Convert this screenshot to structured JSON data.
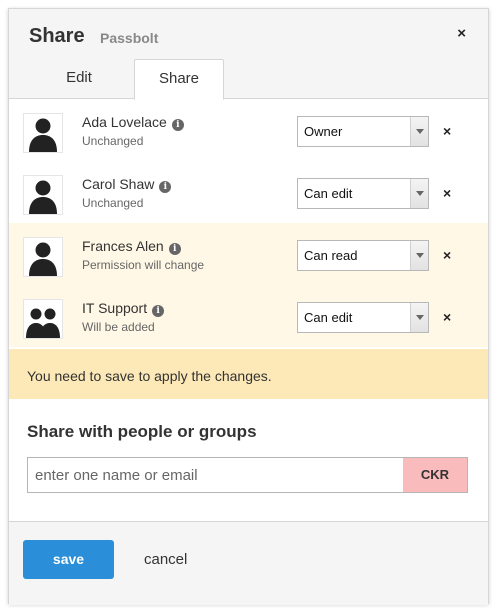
{
  "dialog": {
    "title": "Share",
    "subtitle": "Passbolt",
    "close_label": "×",
    "tabs": [
      {
        "label": "Edit",
        "active": false
      },
      {
        "label": "Share",
        "active": true
      }
    ]
  },
  "permissions": [
    {
      "name": "Ada Lovelace",
      "status": "Unchanged",
      "permission": "Owner",
      "type": "user",
      "changed": false,
      "avatar_icon": "user-icon",
      "info_icon": "info-icon"
    },
    {
      "name": "Carol Shaw",
      "status": "Unchanged",
      "permission": "Can edit",
      "type": "user",
      "changed": false,
      "avatar_icon": "user-icon",
      "info_icon": "info-icon"
    },
    {
      "name": "Frances Alen",
      "status": "Permission will change",
      "permission": "Can read",
      "type": "user",
      "changed": true,
      "avatar_icon": "user-icon",
      "info_icon": "info-icon"
    },
    {
      "name": "IT Support",
      "status": "Will be added",
      "permission": "Can edit",
      "type": "group",
      "changed": true,
      "avatar_icon": "group-icon",
      "info_icon": "info-icon"
    }
  ],
  "delete_label": "×",
  "warning": "You need to save to apply the changes.",
  "share": {
    "title": "Share with people or groups",
    "placeholder": "enter one name or email",
    "avatar_initials": "CKR"
  },
  "footer": {
    "save_label": "save",
    "cancel_label": "cancel"
  },
  "colors": {
    "accent": "#2a8fd8",
    "warning_bg": "#fde8b8",
    "changed_row_bg": "#fff8e6",
    "avatar_chip_bg": "#f9bbbb"
  }
}
